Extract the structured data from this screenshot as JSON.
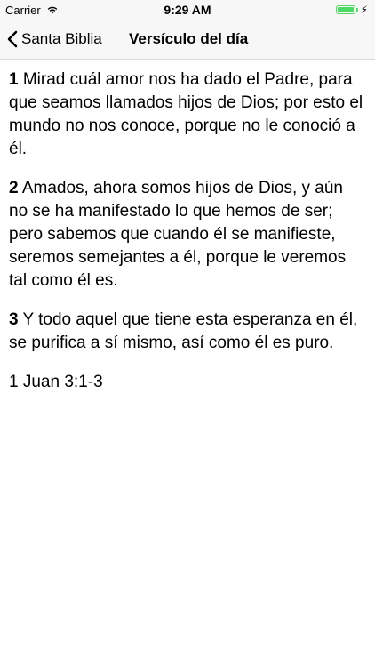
{
  "status": {
    "carrier": "Carrier",
    "time": "9:29 AM",
    "battery_level": 1.0,
    "icons": [
      "wifi-icon",
      "battery-icon",
      "charging-bolt-icon"
    ]
  },
  "nav": {
    "back_label": "Santa Biblia",
    "title": "Versículo del día"
  },
  "verses": [
    {
      "number": "1",
      "text": "Mirad cuál amor nos ha dado el Padre, para que seamos llamados hijos de Dios; por esto el mundo no nos conoce, porque no le conoció a él."
    },
    {
      "number": "2",
      "text": "Amados, ahora somos hijos de Dios, y aún no se ha manifestado lo que hemos de ser; pero sabemos que cuando él se manifieste, seremos semejantes a él, porque le veremos tal como él es."
    },
    {
      "number": "3",
      "text": "Y todo aquel que tiene esta esperanza en él, se purifica a sí mismo, así como él es puro."
    }
  ],
  "reference": "1 Juan 3:1-3",
  "colors": {
    "battery": "#4cd964",
    "bar_background": "#f7f7f7"
  }
}
